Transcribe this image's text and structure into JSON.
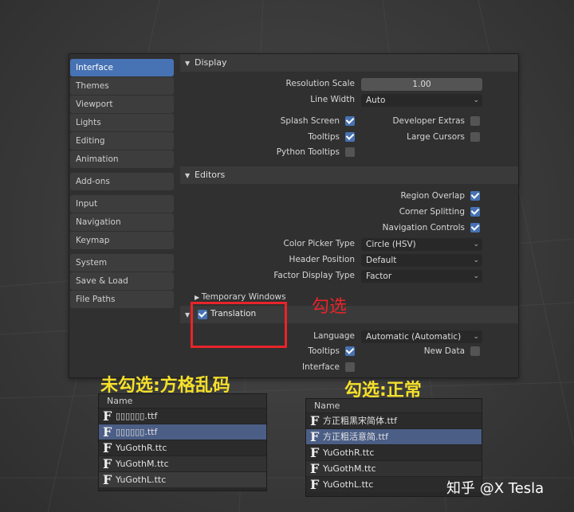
{
  "sidebar": {
    "groups": [
      [
        "Interface",
        "Themes",
        "Viewport",
        "Lights",
        "Editing",
        "Animation"
      ],
      [
        "Add-ons"
      ],
      [
        "Input",
        "Navigation",
        "Keymap"
      ],
      [
        "System",
        "Save & Load",
        "File Paths"
      ]
    ]
  },
  "display": {
    "title": "Display",
    "resolution_scale_label": "Resolution Scale",
    "resolution_scale_value": "1.00",
    "line_width_label": "Line Width",
    "line_width_value": "Auto",
    "splash_screen_label": "Splash Screen",
    "splash_screen_checked": true,
    "developer_extras_label": "Developer Extras",
    "developer_extras_checked": false,
    "tooltips_label": "Tooltips",
    "tooltips_checked": true,
    "large_cursors_label": "Large Cursors",
    "large_cursors_checked": false,
    "python_tooltips_label": "Python Tooltips",
    "python_tooltips_checked": false
  },
  "editors": {
    "title": "Editors",
    "region_overlap_label": "Region Overlap",
    "corner_splitting_label": "Corner Splitting",
    "navigation_controls_label": "Navigation Controls",
    "color_picker_type_label": "Color Picker Type",
    "color_picker_type_value": "Circle (HSV)",
    "header_position_label": "Header Position",
    "header_position_value": "Default",
    "factor_display_type_label": "Factor Display Type",
    "factor_display_type_value": "Factor",
    "temporary_windows_label": "Temporary Windows"
  },
  "translation": {
    "title": "Translation",
    "language_label": "Language",
    "language_value": "Automatic (Automatic)",
    "tooltips_label": "Tooltips",
    "new_data_label": "New Data",
    "interface_label": "Interface"
  },
  "annotations": {
    "check_label": "勾选",
    "unchecked_label": "未勾选:方格乱码",
    "checked_label": "勾选:正常"
  },
  "left_list": {
    "header": "Name",
    "rows": [
      "▯▯▯▯▯▯.ttf",
      "▯▯▯▯▯▯.ttf",
      "YuGothR.ttc",
      "YuGothM.ttc",
      "YuGothL.ttc"
    ],
    "selected_index": 1
  },
  "right_list": {
    "header": "Name",
    "rows": [
      "方正粗黑宋简体.ttf",
      "方正粗活意简.ttf",
      "YuGothR.ttc",
      "YuGothM.ttc",
      "YuGothL.ttc"
    ],
    "selected_index": 1
  },
  "watermark": "知乎 @X Tesla",
  "colors": {
    "accent": "#4772b3",
    "annotation_red": "#e8242a",
    "annotation_yellow": "#f5e02a"
  }
}
